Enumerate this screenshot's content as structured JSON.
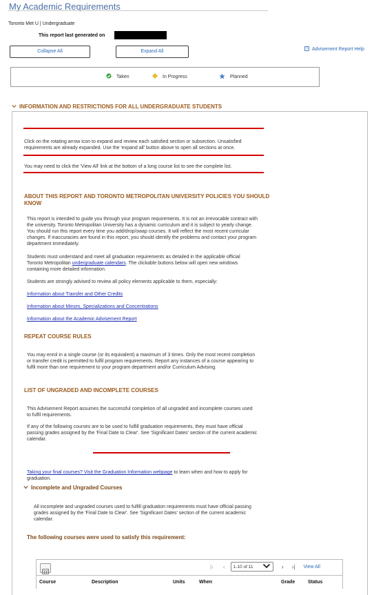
{
  "page": {
    "title": "My Academic Requirements"
  },
  "institution": "Toronto Met U | Undergraduate",
  "report": {
    "generated_label": "This report last generated on"
  },
  "buttons": {
    "collapse": "Collapse All",
    "expand": "Expand All"
  },
  "help": {
    "label": "Advisement Report Help"
  },
  "legend": {
    "taken": "Taken",
    "in_progress": "In Progress",
    "planned": "Planned"
  },
  "section": {
    "title": "INFORMATION AND RESTRICTIONS FOR ALL UNDERGRADUATE STUDENTS",
    "notice1": "Click on the rotating arrow icon to expand and review each satisfied section or subsection. Unsatisfied requirements are already expanded. Use the 'expand all' button above to open all sections at once.",
    "notice2": "You may need to click the 'View All' link at the bottom of a long course list to see the complete list."
  },
  "about": {
    "heading": "ABOUT THIS REPORT AND TORONTO METROPOLITAN UNIVERSITY POLICIES YOU SHOULD KNOW",
    "p1": "This report is intended to guide you through your program requirements. It is not an irrevocable contract with the university. Toronto Metropolitan University has a dynamic curriculum and it is subject to yearly change. You should run this report every time you add/drop/swap courses. It will reflect the most recent curricular changes. If inaccuracies are found in this report, you should identify the problems and contact your program department immediately.",
    "p2_before": "Students must understand and meet all graduation requirements as detailed in the applicable official Toronto Metropolitan ",
    "p2_link": "undergraduate calendars",
    "p2_after": ". The clickable buttons below will open new windows containing more detailed information.",
    "p3": "Students are strongly advised to review all policy elements applicable to them, especially:",
    "link1": "Information about Transfer and Other Credits",
    "link2": "Information about Minors, Specializations and Concentrations",
    "link3": "Information about the Academic Advisement Report"
  },
  "repeat": {
    "heading": "REPEAT COURSE RULES",
    "p1": "You may enrol in a single course (or its equivalent) a maximum of 3 times. Only the most recent completion or transfer credit is permitted to fulfil program requirements. Report any instances of a course appearing to fulfil more than one requirement to your program department and/or Curriculum Advising."
  },
  "ungraded": {
    "heading": "LIST OF UNGRADED AND INCOMPLETE COURSES",
    "p1": "This Advisement Report assumes the successful completion of all ungraded and incomplete courses used to fulfil requirements.",
    "p2": "If any of the following courses are to be used to fulfill graduation requirements, they must have official passing grades assigned by the 'Final Date to Clear'. See 'Significant Dates' section of the current academic calendar."
  },
  "graduation": {
    "link": "Taking your final courses? Visit the Graduation Information webpage",
    "after": " to learn when and how to apply for graduation."
  },
  "incomplete": {
    "heading": "Incomplete and Ungraded Courses",
    "p1": "All incomplete and ungraded courses used to fulfill graduation requirements must have official passing grades assigned by the 'Final Date to Clear'. See 'Significant Dates' section of the current academic calendar.",
    "courses_heading": "The following courses were used to satisfy this requirement:"
  },
  "table": {
    "pager": "1-10 of 11",
    "view_all": "View All",
    "columns": [
      "Course",
      "Description",
      "Units",
      "When",
      "Grade",
      "Status"
    ]
  },
  "colors": {
    "accent_heading": "#9a5a1e",
    "link": "#1c5fa8",
    "alert_line": "#d20000"
  }
}
